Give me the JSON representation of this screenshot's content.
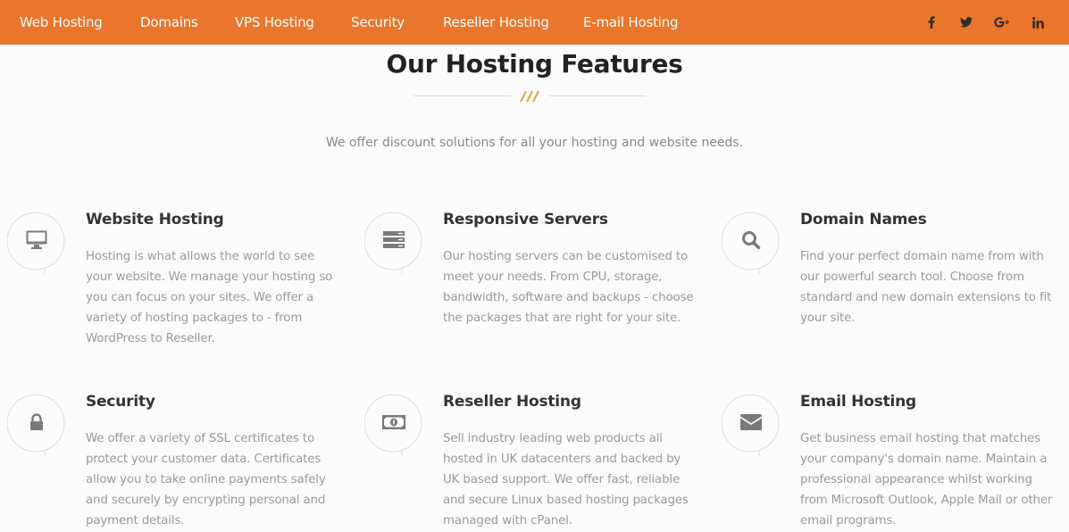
{
  "nav": {
    "items": [
      {
        "label": "Web Hosting"
      },
      {
        "label": "Domains"
      },
      {
        "label": "VPS Hosting"
      },
      {
        "label": "Security"
      },
      {
        "label": "Reseller Hosting"
      },
      {
        "label": "E-mail Hosting"
      }
    ],
    "social": [
      {
        "name": "facebook-icon"
      },
      {
        "name": "twitter-icon"
      },
      {
        "name": "google-plus-icon"
      },
      {
        "name": "linkedin-icon"
      }
    ],
    "colors": {
      "bar": "#e9762b",
      "text": "#ffffff",
      "social": "#2b2b2b"
    }
  },
  "section": {
    "title": "Our Hosting Features",
    "divider_mark": "///",
    "subtitle": "We offer discount solutions for all your hosting and website needs.",
    "accent": "#e9a040"
  },
  "features": [
    {
      "icon": "monitor-icon",
      "title": "Website Hosting",
      "description": "Hosting is what allows the world to see your website. We manage your hosting so you can focus on your sites. We offer a variety of hosting packages to - from WordPress to Reseller."
    },
    {
      "icon": "server-icon",
      "title": "Responsive Servers",
      "description": "Our hosting servers can be customised to meet your needs. From CPU, storage, bandwidth, software and backups - choose the packages that are right for your site."
    },
    {
      "icon": "search-icon",
      "title": "Domain Names",
      "description": "Find your perfect domain name from with our powerful search tool. Choose from standard and new domain extensions to fit your site."
    },
    {
      "icon": "lock-icon",
      "title": "Security",
      "description": "We offer a variety of SSL certificates to protect your customer data. Certificates allow you to take online payments safely and securely by encrypting personal and payment details."
    },
    {
      "icon": "money-icon",
      "title": "Reseller Hosting",
      "description": "Sell industry leading web products all hosted in UK datacenters and backed by UK based support. We offer fast, reliable and secure Linux based hosting packages managed with cPanel."
    },
    {
      "icon": "envelope-icon",
      "title": "Email Hosting",
      "description": "Get business email hosting that matches your company's domain name. Maintain a professional appearance whilst working from Microsoft Outlook, Apple Mail or other email programs."
    }
  ]
}
